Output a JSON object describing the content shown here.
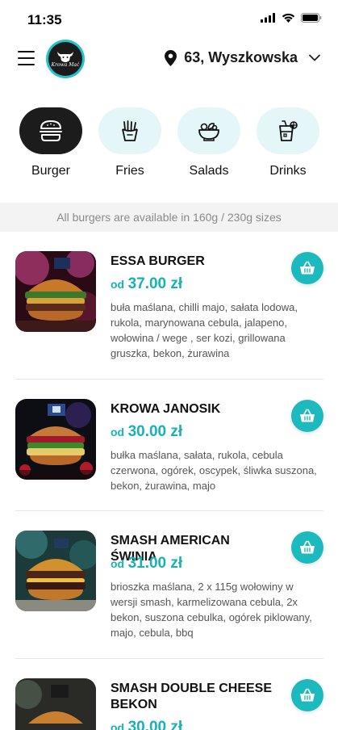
{
  "status_bar": {
    "time": "11:35"
  },
  "header": {
    "logo_text": "Krowa Mać",
    "location": "63, Wyszkowska"
  },
  "categories": [
    {
      "label": "Burger",
      "icon": "burger-icon",
      "active": true
    },
    {
      "label": "Fries",
      "icon": "fries-icon",
      "active": false
    },
    {
      "label": "Salads",
      "icon": "salad-icon",
      "active": false
    },
    {
      "label": "Drinks",
      "icon": "drink-icon",
      "active": false
    }
  ],
  "notice": "All burgers are available in 160g / 230g sizes",
  "products": [
    {
      "name": "ESSA BURGER",
      "price_prefix": "od",
      "price": "37.00 zł",
      "description": "buła maślana, chilli majo, sałata lodowa, rukola, marynowana cebula, jalapeno, wołowina / wege , ser kozi, grillowana gruszka, bekon, żurawina"
    },
    {
      "name": "KROWA JANOSIK",
      "price_prefix": "od",
      "price": "30.00 zł",
      "description": "bułka maślana, sałata, rukola, cebula czerwona, ogórek, oscypek, śliwka suszona, bekon, żurawina, majo"
    },
    {
      "name": "SMASH AMERICAN ŚWINIA",
      "price_prefix": "od",
      "price": "31.00 zł",
      "description": "brioszka maślana, 2 x 115g wołowiny w wersji smash, karmelizowana cebula, 2x bekon, suszona cebulka, ogórek piklowany, majo, cebula, bbq"
    },
    {
      "name": "SMASH DOUBLE CHEESE BEKON",
      "price_prefix": "od",
      "price": "30.00 zł",
      "description": ""
    }
  ],
  "colors": {
    "accent": "#1cbabe",
    "price": "#17b2b6",
    "category_bg": "#e4f6f8",
    "active_category": "#1c1c1c"
  }
}
